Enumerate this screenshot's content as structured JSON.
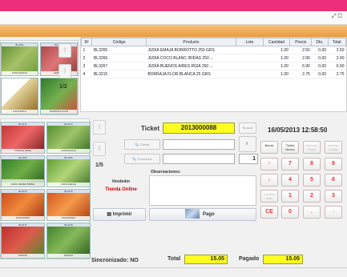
{
  "products_panel": {
    "top_cards": [
      {
        "code": "BL3201",
        "name": "JUDIA EMAJA"
      },
      {
        "code": "BL3301",
        "name": "CEBOLLA"
      },
      {
        "code": "",
        "name": "JUDIA BOLA"
      },
      {
        "code": "",
        "name": "BORRAJA FLOR"
      }
    ],
    "top_page": "1/2",
    "grid_cards": [
      {
        "code": "BL3271",
        "name": "TOMATE PERA"
      },
      {
        "code": "BL3272",
        "name": "JUDIA ENAJA"
      },
      {
        "code": "BL3263",
        "name": "JUDIA VERDE BOBAL"
      },
      {
        "code": "BL3265",
        "name": "JUDIA HELDA"
      },
      {
        "code": "BL3266",
        "name": "JUDIA BOBAL RDO"
      },
      {
        "code": "BL3274",
        "name": "PEPINO DE"
      },
      {
        "code": "BL3268",
        "name": "JUDIA PLANA"
      },
      {
        "code": "BL3273",
        "name": "JUDIA VERDE"
      },
      {
        "code": "BL3270",
        "name": "ZANAHORIA"
      },
      {
        "code": "BL3275",
        "name": "ZANAHORIA"
      },
      {
        "code": "BL3277",
        "name": "PEPINO"
      },
      {
        "code": "BL3278",
        "name": "PEPINO"
      }
    ],
    "bottom_page": "1/5"
  },
  "line_table": {
    "headers": [
      "Nº",
      "Código",
      "Producto",
      "Lote",
      "Cantidad",
      "Precio",
      "Dto.",
      "Total"
    ],
    "rows": [
      [
        "1",
        "BL3265",
        "JUDIA EMAJA BORROTTO 250 GRS",
        "",
        "1.00",
        "2.50",
        "0.00",
        "2.50"
      ],
      [
        "2",
        "BL3266",
        "JUDIA COCO BLANC IRIDAS 250 ...",
        "",
        "1.00",
        "2.90",
        "0.00",
        "2.90"
      ],
      [
        "3",
        "BL3267",
        "JUDIA BUENOS AIRES RGIA 250 ...",
        "",
        "1.00",
        "6.90",
        "0.00",
        "6.90"
      ],
      [
        "4",
        "BL3215",
        "BORRAJA FLOR BLANCA 25 GRS",
        "",
        "1.00",
        "2.75",
        "0.00",
        "2.75"
      ]
    ]
  },
  "ticket": {
    "label": "Ticket",
    "number": "2013000088",
    "client_btn": "Cliente",
    "proveedor_btn": "Proveedor",
    "qty_value": "1",
    "page": "1/5"
  },
  "vendor": {
    "label": "Vendedor",
    "name": "Tienda Online"
  },
  "observaciones_label": "Observaciones:",
  "datetime": "16/05/2013 12:58:50",
  "keypad": {
    "function_keys": [
      "Borrar",
      "Ticket Nuevo",
      "Cancelar Ticket",
      "Imprimir Código"
    ],
    "rows": [
      [
        "7",
        "8",
        "9"
      ],
      [
        "4",
        "5",
        "6"
      ],
      [
        "1",
        "2",
        "3"
      ],
      [
        "CE",
        "0",
        "."
      ]
    ],
    "side_keys": [
      "↑",
      "↓",
      "Cambiar Vista"
    ]
  },
  "buttons": {
    "print": "Imprimir",
    "pay": "Pago"
  },
  "footer": {
    "sync_label": "Sincronizado:",
    "sync_value": "NO",
    "total_label": "Total",
    "total_value": "15.05",
    "paid_label": "Pagado",
    "paid_value": "15.05"
  },
  "colors": {
    "topbar": "#ee2e7b",
    "orange_bar": "#ec9a3c",
    "highlight_yellow": "#ffff22",
    "vendor_red": "#cc0000"
  }
}
